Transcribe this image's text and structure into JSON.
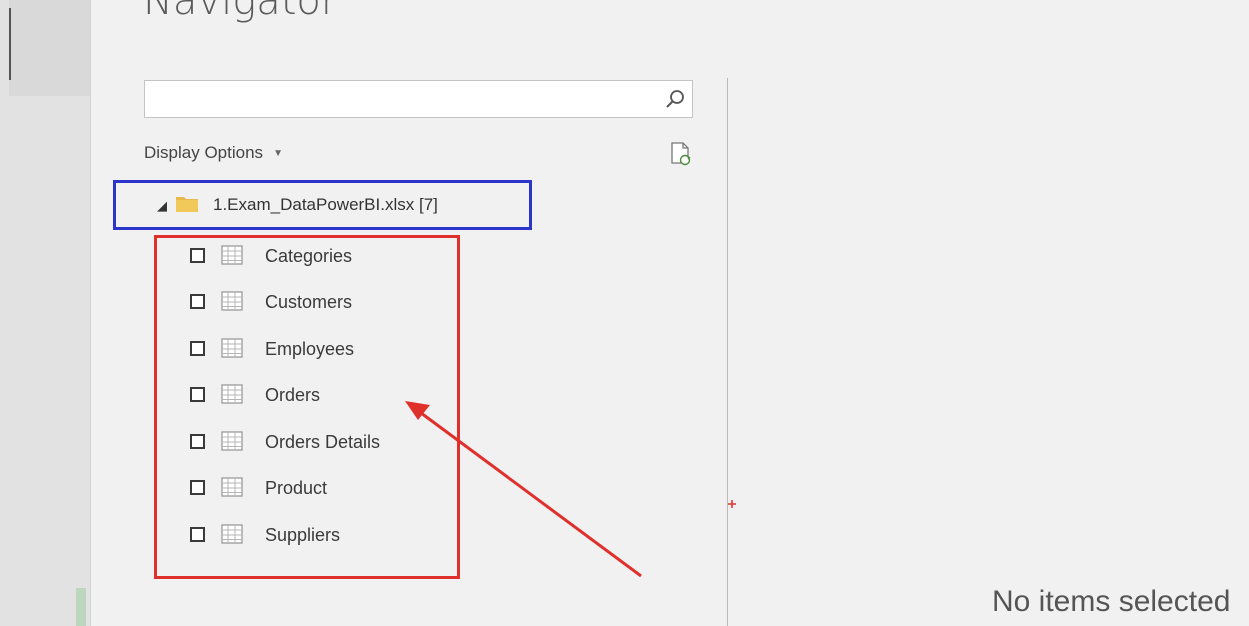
{
  "dialog": {
    "title": "Navigator",
    "search": {
      "value": "",
      "placeholder": ""
    },
    "display_options_label": "Display Options",
    "tree": {
      "root_label": "1.Exam_DataPowerBI.xlsx [7]",
      "items": [
        {
          "label": "Categories",
          "checked": false
        },
        {
          "label": "Customers",
          "checked": false
        },
        {
          "label": "Employees",
          "checked": false
        },
        {
          "label": "Orders",
          "checked": false
        },
        {
          "label": "Orders Details",
          "checked": false
        },
        {
          "label": "Product",
          "checked": false
        },
        {
          "label": "Suppliers",
          "checked": false
        }
      ]
    },
    "preview": {
      "empty_message": "No items selected"
    }
  },
  "annotations": {
    "root_highlight_color": "#2b35c9",
    "items_highlight_color": "#e0302c",
    "arrow_color": "#e0302c"
  },
  "icons": {
    "search": "search-icon",
    "refresh": "refresh-icon",
    "expand": "expand-triangle-icon",
    "folder": "folder-icon",
    "table": "table-icon"
  }
}
